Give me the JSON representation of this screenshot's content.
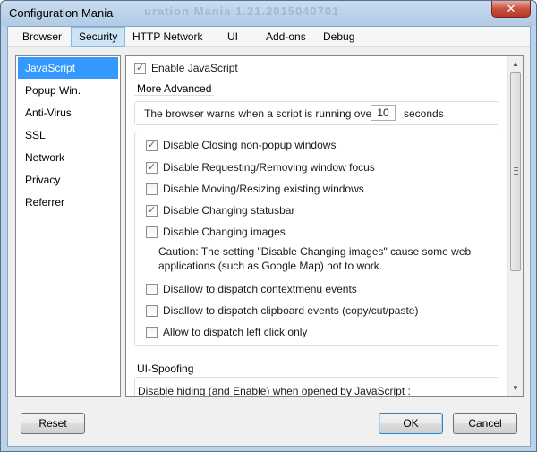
{
  "window": {
    "title": "Configuration Mania",
    "ghost_title": "uration Mania    1.21.2015040701",
    "close_glyph": "✕"
  },
  "menu": {
    "tabs": [
      "Browser",
      "Security",
      "HTTP Network",
      "UI",
      "Add-ons",
      "Debug"
    ],
    "active": "Security"
  },
  "sidebar": {
    "items": [
      "JavaScript",
      "Popup Win.",
      "Anti-Virus",
      "SSL",
      "Network",
      "Privacy",
      "Referrer"
    ],
    "selected": "JavaScript"
  },
  "content": {
    "enable_js": {
      "label": "Enable JavaScript",
      "checked": true
    },
    "more_advanced": {
      "title": "More Advanced",
      "warn_prefix": "The browser warns when a script is running over",
      "warn_value": "10",
      "warn_suffix": "seconds",
      "options": [
        {
          "label": "Disable Closing non-popup windows",
          "checked": true
        },
        {
          "label": "Disable Requesting/Removing window focus",
          "checked": true
        },
        {
          "label": "Disable Moving/Resizing existing windows",
          "checked": false
        },
        {
          "label": "Disable Changing statusbar",
          "checked": true
        },
        {
          "label": "Disable Changing images",
          "checked": false
        },
        {
          "label": "Disallow to dispatch contextmenu events",
          "checked": false
        },
        {
          "label": "Disallow to dispatch clipboard events (copy/cut/paste)",
          "checked": false
        },
        {
          "label": "Allow to dispatch left click only",
          "checked": false
        }
      ],
      "caution_line1": "Caution: The setting \"Disable Changing images\" cause some web",
      "caution_line2": "applications (such as Google Map) not to work."
    },
    "ui_spoofing": {
      "title": "UI-Spoofing",
      "text": "Disable hiding (and Enable) when opened by JavaScript :"
    }
  },
  "buttons": {
    "reset": "Reset",
    "ok": "OK",
    "cancel": "Cancel"
  },
  "icons": {
    "check": "✓",
    "scroll_up": "▲",
    "scroll_down": "▼"
  }
}
